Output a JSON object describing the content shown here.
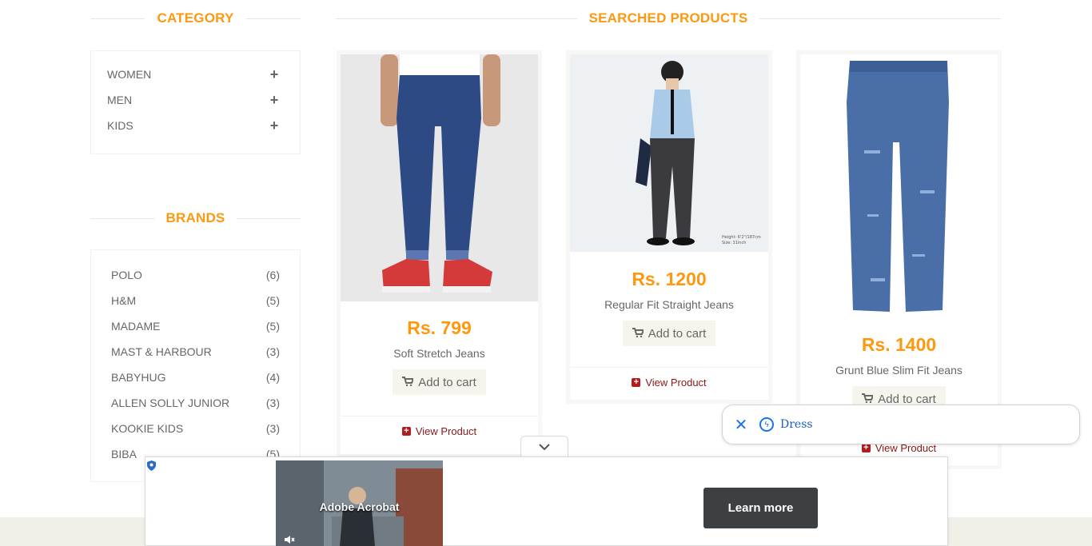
{
  "sidebar": {
    "category_title": "CATEGORY",
    "categories": [
      {
        "label": "WOMEN",
        "icon": "plus-icon"
      },
      {
        "label": "MEN",
        "icon": "plus-icon"
      },
      {
        "label": "KIDS",
        "icon": "plus-icon"
      }
    ],
    "brands_title": "BRANDS",
    "brands": [
      {
        "name": "POLO",
        "count": "(6)"
      },
      {
        "name": "H&M",
        "count": "(5)"
      },
      {
        "name": "MADAME",
        "count": "(5)"
      },
      {
        "name": "MAST & HARBOUR",
        "count": "(3)"
      },
      {
        "name": "BABYHUG",
        "count": "(4)"
      },
      {
        "name": "ALLEN SOLLY JUNIOR",
        "count": "(3)"
      },
      {
        "name": "KOOKIE KIDS",
        "count": "(3)"
      },
      {
        "name": "BIBA",
        "count": "(5)"
      }
    ]
  },
  "main": {
    "title": "SEARCHED PRODUCTS",
    "products": [
      {
        "price": "Rs. 799",
        "name": "Soft Stretch Jeans",
        "cart_label": "Add to cart",
        "view_label": "View Product"
      },
      {
        "price": "Rs. 1200",
        "name": "Regular Fit Straight Jeans",
        "cart_label": "Add to cart",
        "view_label": "View Product",
        "image_caption_1": "Height: 6'2\"/187cm",
        "image_caption_2": "Size: 31inch"
      },
      {
        "price": "Rs. 1400",
        "name": "Grunt Blue Slim Fit Jeans",
        "cart_label": "Add to cart",
        "view_label": "View Product"
      }
    ]
  },
  "search_chip": {
    "query": "Dress",
    "close_icon": "close-icon",
    "bolt_icon": "bolt-icon"
  },
  "ad": {
    "video_text": "Adobe Acrobat",
    "cta_label": "Learn more"
  },
  "colors": {
    "accent": "#fe980f",
    "link": "#8b1818",
    "footer": "#f0f0e9"
  }
}
